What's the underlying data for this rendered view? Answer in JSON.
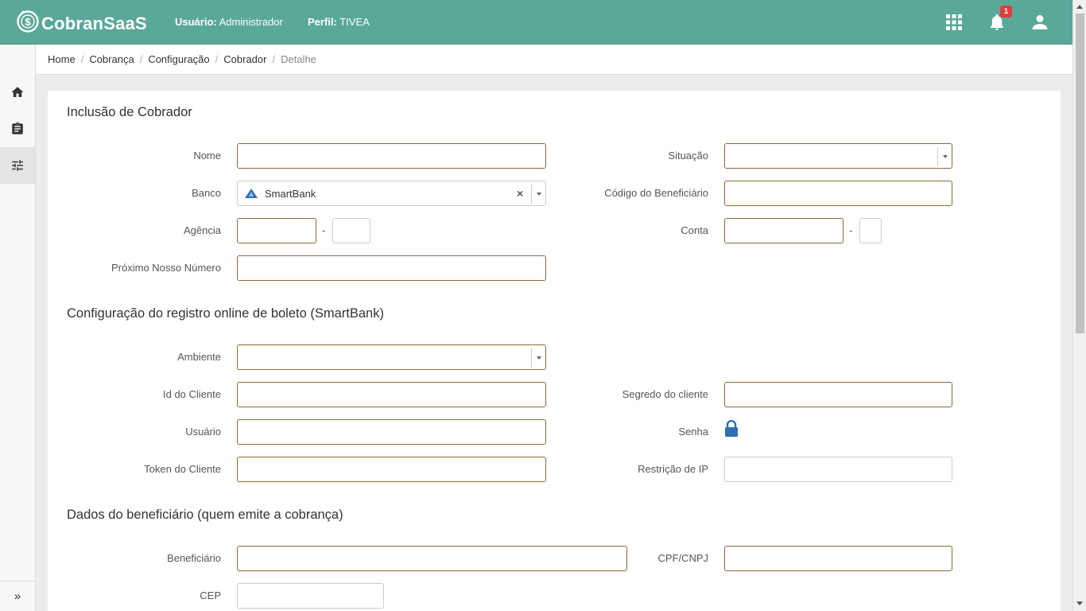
{
  "app": {
    "brand": "CobranSaaS",
    "user_label": "Usuário:",
    "user_value": "Administrador",
    "profile_label": "Perfil:",
    "profile_value": "TIVEA",
    "notification_count": "1",
    "header_bg": "#5aa898"
  },
  "sidebar": {
    "items": [
      {
        "icon": "home-icon"
      },
      {
        "icon": "clipboard-icon"
      },
      {
        "icon": "sliders-icon",
        "active": true
      }
    ],
    "expand_label": "»"
  },
  "breadcrumb": [
    "Home",
    "Cobrança",
    "Configuração",
    "Cobrador",
    "Detalhe"
  ],
  "form": {
    "title": "Inclusão de Cobrador",
    "fields": {
      "nome": {
        "label": "Nome",
        "value": ""
      },
      "situacao": {
        "label": "Situação",
        "value": ""
      },
      "banco": {
        "label": "Banco",
        "value": "SmartBank"
      },
      "codigo_beneficiario": {
        "label": "Código do Beneficiário",
        "value": ""
      },
      "agencia": {
        "label": "Agência",
        "value": "",
        "digit": ""
      },
      "conta": {
        "label": "Conta",
        "value": "",
        "digit": ""
      },
      "proximo_nosso_numero": {
        "label": "Próximo Nosso Número",
        "value": ""
      }
    },
    "separator": "-"
  },
  "online_config": {
    "title": "Configuração do registro online de boleto (SmartBank)",
    "fields": {
      "ambiente": {
        "label": "Ambiente",
        "value": ""
      },
      "id_cliente": {
        "label": "Id do Cliente",
        "value": ""
      },
      "segredo_cliente": {
        "label": "Segredo do cliente",
        "value": ""
      },
      "usuario": {
        "label": "Usuário",
        "value": ""
      },
      "senha": {
        "label": "Senha",
        "icon": "lock-icon"
      },
      "token_cliente": {
        "label": "Token do Cliente",
        "value": ""
      },
      "restricao_ip": {
        "label": "Restrição de IP",
        "value": ""
      }
    }
  },
  "beneficiario": {
    "title": "Dados do beneficiário (quem emite a cobrança)",
    "fields": {
      "beneficiario": {
        "label": "Beneficiário",
        "value": ""
      },
      "cpf_cnpj": {
        "label": "CPF/CNPJ",
        "value": ""
      },
      "cep": {
        "label": "CEP",
        "value": ""
      }
    }
  }
}
